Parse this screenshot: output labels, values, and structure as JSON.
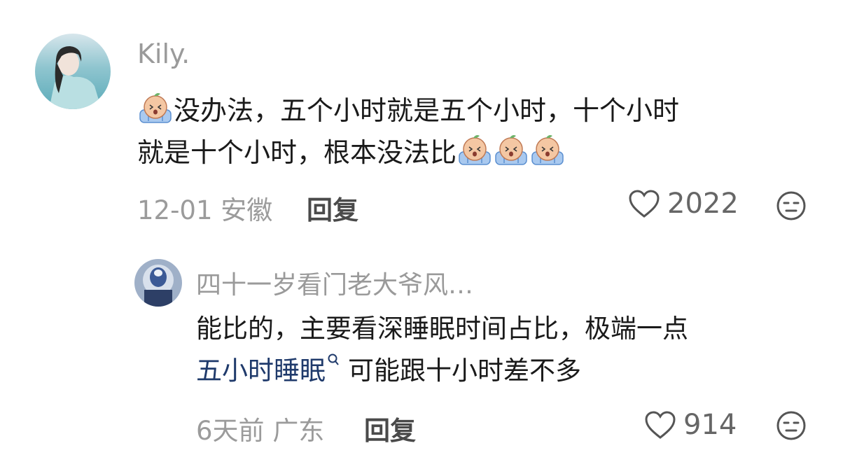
{
  "comments": [
    {
      "username": "Kily.",
      "line1": "没办法，五个小时就是五个小时，十个小时",
      "line2": "就是十个小时，根本没法比",
      "date": "12-01",
      "location": "安徽",
      "reply_label": "回复",
      "like_count": "2022"
    }
  ],
  "reply": {
    "username": "四十一岁看门老大爷风…",
    "line1": "能比的，主要看深睡眠时间占比，极端一点",
    "link_text": "五小时睡眠",
    "line2_rest": "可能跟十小时差不多",
    "date": "6天前",
    "location": "广东",
    "reply_label": "回复",
    "like_count": "914"
  },
  "icons": {
    "emoji": "crying-peach-emoji",
    "like": "heart-outline-icon",
    "dislike": "meh-face-icon",
    "search": "search-link-icon"
  },
  "colors": {
    "link": "#1f3a6b",
    "meta": "#9b9b9b",
    "emoji_skin": "#f4c7a3",
    "emoji_body": "#a9c9ef"
  }
}
